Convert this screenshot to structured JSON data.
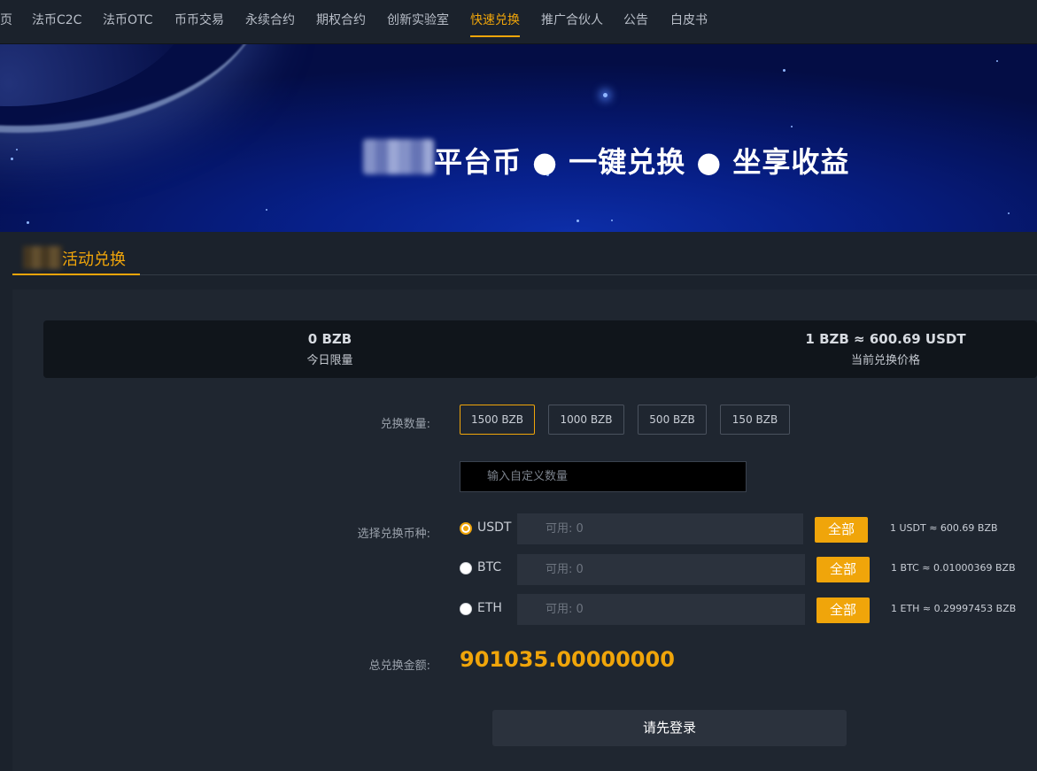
{
  "nav": {
    "items": [
      "页",
      "法币C2C",
      "法币OTC",
      "币币交易",
      "永续合约",
      "期权合约",
      "创新实验室",
      "快速兑换",
      "推广合伙人",
      "公告",
      "白皮书"
    ],
    "active_index": 7
  },
  "banner": {
    "title": "平台币 ● 一键兑换 ● 坐享收益"
  },
  "section": {
    "tab_label": "活动兑换"
  },
  "stats": {
    "daily_limit_value": "0 BZB",
    "daily_limit_label": "今日限量",
    "price_value": "1 BZB ≈ 600.69 USDT",
    "price_label": "当前兑换价格"
  },
  "form": {
    "amount_label": "兑换数量:",
    "amount_options": [
      "1500 BZB",
      "1000 BZB",
      "500 BZB",
      "150 BZB"
    ],
    "selected_amount_index": 0,
    "custom_placeholder": "输入自定义数量",
    "currency_label": "选择兑换币种:",
    "currencies": [
      {
        "name": "USDT",
        "available": "可用: 0",
        "all_label": "全部",
        "rate": "1 USDT ≈ 600.69 BZB",
        "checked": true
      },
      {
        "name": "BTC",
        "available": "可用: 0",
        "all_label": "全部",
        "rate": "1 BTC ≈ 0.01000369 BZB",
        "checked": false
      },
      {
        "name": "ETH",
        "available": "可用: 0",
        "all_label": "全部",
        "rate": "1 ETH ≈ 0.29997453 BZB",
        "checked": false
      }
    ],
    "total_label": "总兑换金额:",
    "total_value": "901035.00000000",
    "login_button": "请先登录"
  },
  "colors": {
    "accent": "#f0a50a",
    "background": "#1b222c",
    "panel": "#1f2630"
  }
}
